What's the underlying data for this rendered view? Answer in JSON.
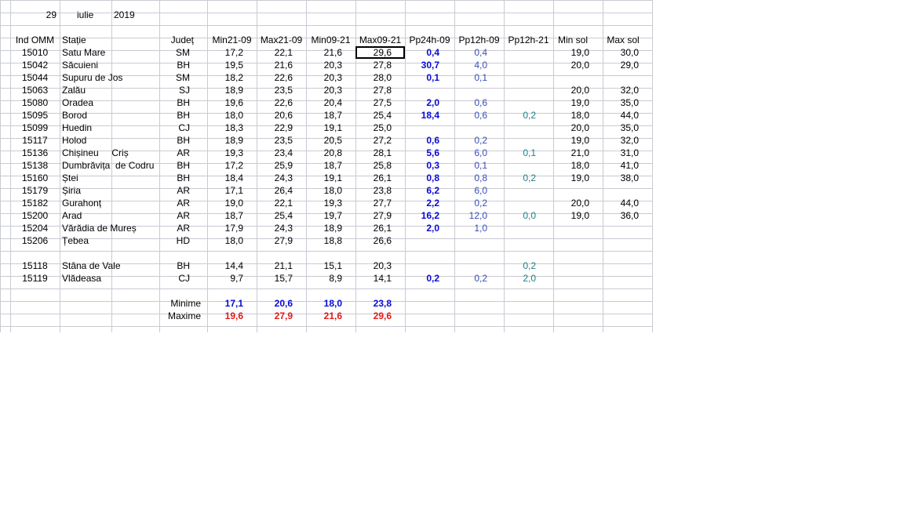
{
  "date_row": {
    "day": "29",
    "month": "iulie",
    "year": "2019"
  },
  "headers": [
    "Ind OMM",
    "Stație",
    "Județ",
    "Min21-09",
    "Max21-09",
    "Min09-21",
    "Max09-21",
    "Pp24h-09",
    "Pp12h-09",
    "Pp12h-21",
    "Min sol",
    "Max sol"
  ],
  "rows": [
    {
      "ind": "15010",
      "statie": "Satu Mare",
      "judet": "SM",
      "min2109": "17,2",
      "max2109": "22,1",
      "min0921": "21,6",
      "max0921": "29,6",
      "pp24": "0,4",
      "pp12a": "0,4",
      "pp12b": "",
      "minsol": "19,0",
      "maxsol": "30,0"
    },
    {
      "ind": "15042",
      "statie": "Săcuieni",
      "judet": "BH",
      "min2109": "19,5",
      "max2109": "21,6",
      "min0921": "20,3",
      "max0921": "27,8",
      "pp24": "30,7",
      "pp12a": "4,0",
      "pp12b": "",
      "minsol": "20,0",
      "maxsol": "29,0"
    },
    {
      "ind": "15044",
      "statie": "Supuru de Jos",
      "judet": "SM",
      "min2109": "18,2",
      "max2109": "22,6",
      "min0921": "20,3",
      "max0921": "28,0",
      "pp24": "0,1",
      "pp12a": "0,1",
      "pp12b": "",
      "minsol": "",
      "maxsol": ""
    },
    {
      "ind": "15063",
      "statie": "Zalău",
      "judet": "SJ",
      "min2109": "18,9",
      "max2109": "23,5",
      "min0921": "20,3",
      "max0921": "27,8",
      "pp24": "",
      "pp12a": "",
      "pp12b": "",
      "minsol": "20,0",
      "maxsol": "32,0"
    },
    {
      "ind": "15080",
      "statie": "Oradea",
      "judet": "BH",
      "min2109": "19,6",
      "max2109": "22,6",
      "min0921": "20,4",
      "max0921": "27,5",
      "pp24": "2,0",
      "pp12a": "0,6",
      "pp12b": "",
      "minsol": "19,0",
      "maxsol": "35,0"
    },
    {
      "ind": "15095",
      "statie": "Borod",
      "judet": "BH",
      "min2109": "18,0",
      "max2109": "20,6",
      "min0921": "18,7",
      "max0921": "25,4",
      "pp24": "18,4",
      "pp12a": "0,6",
      "pp12b": "0,2",
      "minsol": "18,0",
      "maxsol": "44,0"
    },
    {
      "ind": "15099",
      "statie": "Huedin",
      "judet": "CJ",
      "min2109": "18,3",
      "max2109": "22,9",
      "min0921": "19,1",
      "max0921": "25,0",
      "pp24": "",
      "pp12a": "",
      "pp12b": "",
      "minsol": "20,0",
      "maxsol": "35,0"
    },
    {
      "ind": "15117",
      "statie": "Holod",
      "judet": "BH",
      "min2109": "18,9",
      "max2109": "23,5",
      "min0921": "20,5",
      "max0921": "27,2",
      "pp24": "0,6",
      "pp12a": "0,2",
      "pp12b": "",
      "minsol": "19,0",
      "maxsol": "32,0"
    },
    {
      "ind": "15136",
      "statie": "Chișineu     Criș",
      "judet": "AR",
      "min2109": "19,3",
      "max2109": "23,4",
      "min0921": "20,8",
      "max0921": "28,1",
      "pp24": "5,6",
      "pp12a": "6,0",
      "pp12b": "0,1",
      "minsol": "21,0",
      "maxsol": "31,0"
    },
    {
      "ind": "15138",
      "statie": "Dumbrăvița  de Codru",
      "judet": "BH",
      "min2109": "17,2",
      "max2109": "25,9",
      "min0921": "18,7",
      "max0921": "25,8",
      "pp24": "0,3",
      "pp12a": "0,1",
      "pp12b": "",
      "minsol": "18,0",
      "maxsol": "41,0"
    },
    {
      "ind": "15160",
      "statie": "Ștei",
      "judet": "BH",
      "min2109": "18,4",
      "max2109": "24,3",
      "min0921": "19,1",
      "max0921": "26,1",
      "pp24": "0,8",
      "pp12a": "0,8",
      "pp12b": "0,2",
      "minsol": "19,0",
      "maxsol": "38,0"
    },
    {
      "ind": "15179",
      "statie": "Șiria",
      "judet": "AR",
      "min2109": "17,1",
      "max2109": "26,4",
      "min0921": "18,0",
      "max0921": "23,8",
      "pp24": "6,2",
      "pp12a": "6,0",
      "pp12b": "",
      "minsol": "",
      "maxsol": ""
    },
    {
      "ind": "15182",
      "statie": "Gurahonț",
      "judet": "AR",
      "min2109": "19,0",
      "max2109": "22,1",
      "min0921": "19,3",
      "max0921": "27,7",
      "pp24": "2,2",
      "pp12a": "0,2",
      "pp12b": "",
      "minsol": "20,0",
      "maxsol": "44,0"
    },
    {
      "ind": "15200",
      "statie": "Arad",
      "judet": "AR",
      "min2109": "18,7",
      "max2109": "25,4",
      "min0921": "19,7",
      "max0921": "27,9",
      "pp24": "16,2",
      "pp12a": "12,0",
      "pp12b": "0,0",
      "minsol": "19,0",
      "maxsol": "36,0"
    },
    {
      "ind": "15204",
      "statie": "Vărădia de Mureș",
      "judet": "AR",
      "min2109": "17,9",
      "max2109": "24,3",
      "min0921": "18,9",
      "max0921": "26,1",
      "pp24": "2,0",
      "pp12a": "1,0",
      "pp12b": "",
      "minsol": "",
      "maxsol": ""
    },
    {
      "ind": "15206",
      "statie": "Țebea",
      "judet": "HD",
      "min2109": "18,0",
      "max2109": "27,9",
      "min0921": "18,8",
      "max0921": "26,6",
      "pp24": "",
      "pp12a": "",
      "pp12b": "",
      "minsol": "",
      "maxsol": ""
    }
  ],
  "mountain_rows": [
    {
      "ind": "15118",
      "statie": "Stâna de Vale",
      "judet": "BH",
      "min2109": "14,4",
      "max2109": "21,1",
      "min0921": "15,1",
      "max0921": "20,3",
      "pp24": "",
      "pp12a": "",
      "pp12b": "0,2",
      "minsol": "",
      "maxsol": ""
    },
    {
      "ind": "15119",
      "statie": "Vlădeasa",
      "judet": "CJ",
      "min2109": "9,7",
      "max2109": "15,7",
      "min0921": "8,9",
      "max0921": "14,1",
      "pp24": "0,2",
      "pp12a": "0,2",
      "pp12b": "2,0",
      "minsol": "",
      "maxsol": ""
    }
  ],
  "summary": {
    "min_label": "Minime",
    "max_label": "Maxime",
    "minime": [
      "17,1",
      "20,6",
      "18,0",
      "23,8"
    ],
    "maxime": [
      "19,6",
      "27,9",
      "21,6",
      "29,6"
    ]
  },
  "colors": {
    "grid": "#c9cbd3",
    "bold_blue": "#0a0ad8",
    "pp_blue": "#3a4fb8",
    "teal": "#208088",
    "red": "#e01818"
  }
}
